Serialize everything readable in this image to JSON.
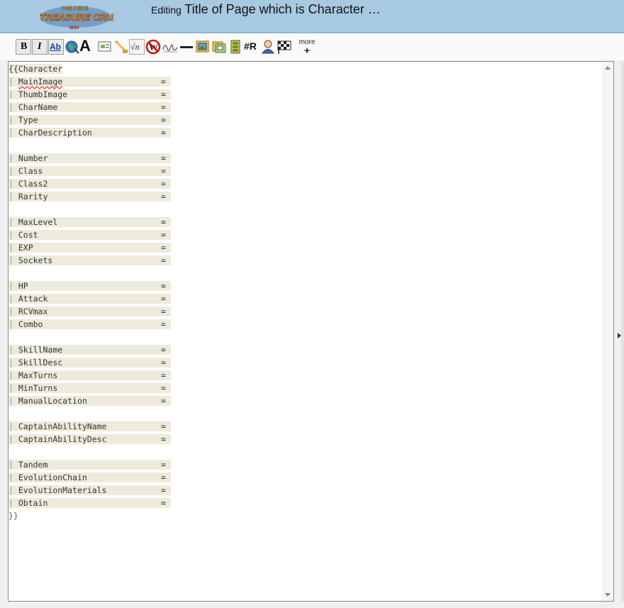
{
  "header": {
    "editing_label": "Editing",
    "page_title": "Title of Page which is Character …",
    "logo_lines": [
      "ONE PIECE",
      "TREASURE CRUISE",
      "WIKI"
    ]
  },
  "toolbar": {
    "buttons": [
      {
        "name": "bold-button",
        "label": "B"
      },
      {
        "name": "italic-button",
        "label": "I"
      },
      {
        "name": "internal-link-button",
        "label": "Ab"
      },
      {
        "name": "external-link-button",
        "label": ""
      },
      {
        "name": "headline-button",
        "label": "A"
      },
      {
        "name": "embedded-file-button",
        "label": ""
      },
      {
        "name": "media-file-button",
        "label": ""
      },
      {
        "name": "math-formula-button",
        "label": "√n"
      },
      {
        "name": "nowiki-button",
        "label": "W"
      },
      {
        "name": "signature-button",
        "label": ""
      },
      {
        "name": "horizontal-line-button",
        "label": ""
      },
      {
        "name": "gallery-button",
        "label": ""
      },
      {
        "name": "insert-template-button",
        "label": ""
      },
      {
        "name": "insert-table-button",
        "label": ""
      },
      {
        "name": "redirect-button",
        "label": "#R"
      },
      {
        "name": "user-button",
        "label": ""
      },
      {
        "name": "race-flag-button",
        "label": ""
      }
    ],
    "more_label": "more",
    "more_plus": "+"
  },
  "editor": {
    "open": "{{Character",
    "close": "}}",
    "bar": "|",
    "eq": "=",
    "groups": [
      [
        "MainImage",
        "ThumbImage",
        "CharName",
        "Type",
        "CharDescription"
      ],
      [
        "Number",
        "Class",
        "Class2",
        "Rarity"
      ],
      [
        "MaxLevel",
        "Cost",
        "EXP",
        "Sockets"
      ],
      [
        "HP",
        "Attack",
        "RCVmax",
        "Combo"
      ],
      [
        "SkillName",
        "SkillDesc",
        "MaxTurns",
        "MinTurns",
        "ManualLocation"
      ],
      [
        "CaptainAbilityName",
        "CaptainAbilityDesc"
      ],
      [
        "Tandem",
        "EvolutionChain",
        "EvolutionMaterials",
        "Obtain"
      ]
    ]
  }
}
